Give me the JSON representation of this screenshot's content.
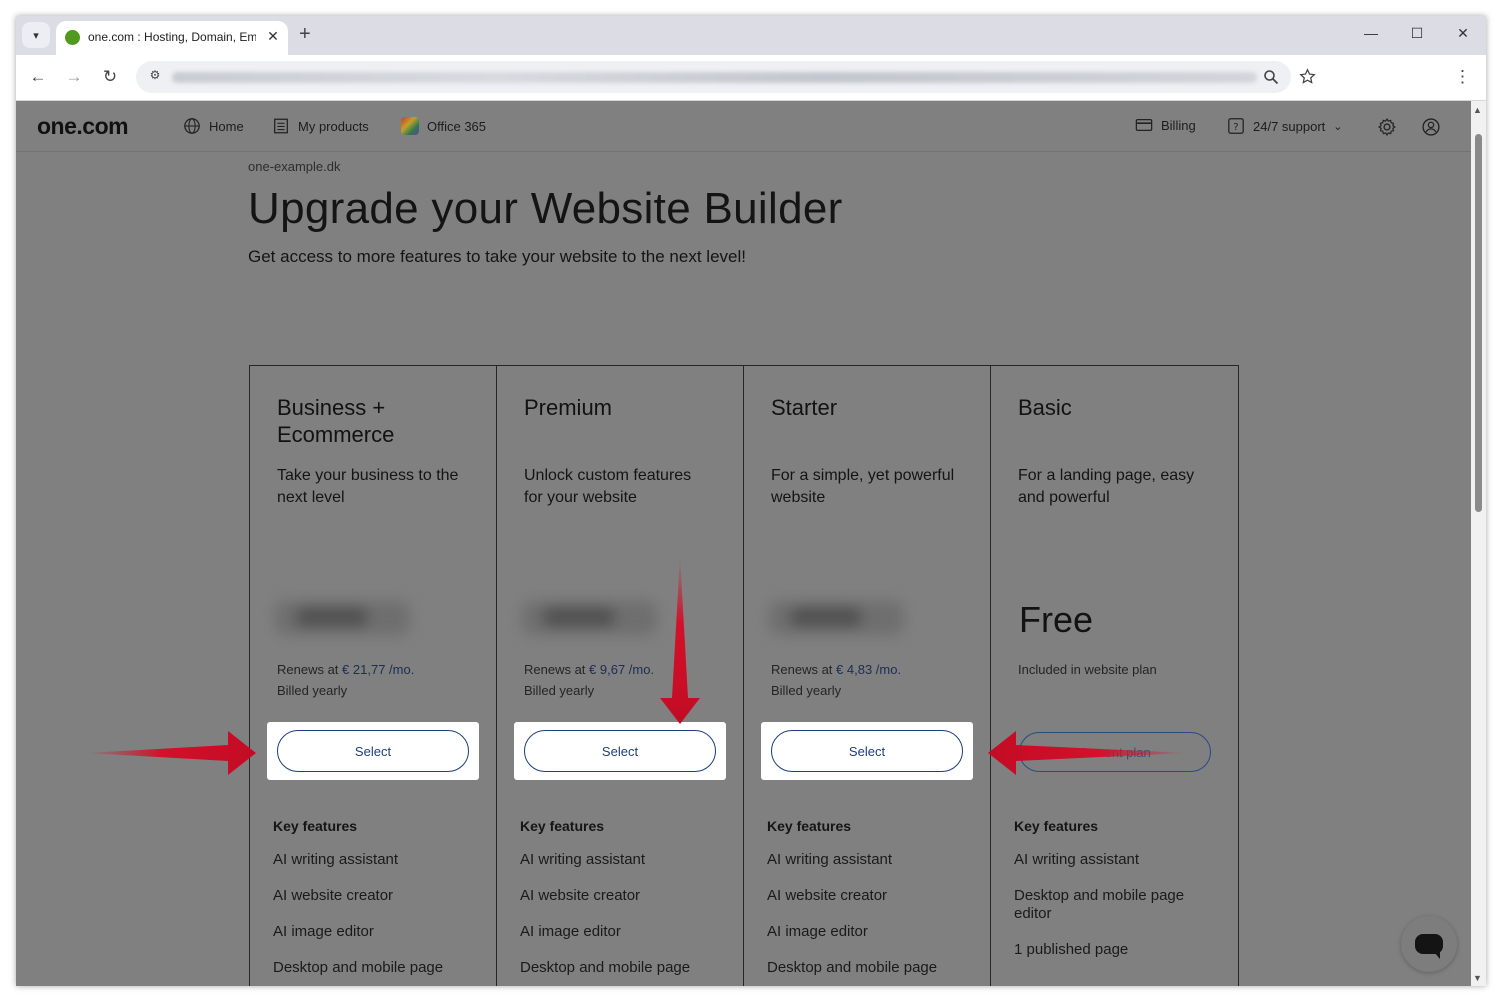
{
  "browser": {
    "tab_title": "one.com : Hosting, Domain, Em",
    "tab_close": "✕",
    "new_tab": "+",
    "minimize": "—",
    "maximize": "☐",
    "close": "✕",
    "back": "←",
    "forward": "→",
    "reload": "↻",
    "menu": "⋮"
  },
  "sitenav": {
    "logo": "one.com",
    "home": "Home",
    "products": "My products",
    "office": "Office 365",
    "billing": "Billing",
    "support": "24/7 support"
  },
  "page": {
    "domain": "one-example.dk",
    "title": "Upgrade your Website Builder",
    "subtitle": "Get access to more features to take your website to the next level!"
  },
  "plans": [
    {
      "name": "Business + Ecommerce",
      "description": "Take your business to the next level",
      "renews_prefix": "Renews at ",
      "renews_price": "€ 21,77 /mo.",
      "billed": "Billed yearly",
      "button": "Select",
      "features_title": "Key features",
      "features": [
        "AI writing assistant",
        "AI website creator",
        "AI image editor",
        "Desktop and mobile page"
      ]
    },
    {
      "name": "Premium",
      "description": "Unlock custom features for your website",
      "renews_prefix": "Renews at ",
      "renews_price": "€ 9,67 /mo.",
      "billed": "Billed yearly",
      "button": "Select",
      "features_title": "Key features",
      "features": [
        "AI writing assistant",
        "AI website creator",
        "AI image editor",
        "Desktop and mobile page"
      ]
    },
    {
      "name": "Starter",
      "description": "For a simple, yet powerful website",
      "renews_prefix": "Renews at ",
      "renews_price": "€ 4,83 /mo.",
      "billed": "Billed yearly",
      "button": "Select",
      "features_title": "Key features",
      "features": [
        "AI writing assistant",
        "AI website creator",
        "AI image editor",
        "Desktop and mobile page"
      ]
    },
    {
      "name": "Basic",
      "description": "For a landing page, easy and powerful",
      "price": "Free",
      "included": "Included in website plan",
      "button": "Current plan",
      "features_title": "Key features",
      "features": [
        "AI writing assistant",
        "Desktop and mobile page editor",
        "1 published page"
      ]
    }
  ],
  "colors": {
    "annotation_arrow": "#d4102a",
    "brand_blue": "#1d3f7a"
  }
}
